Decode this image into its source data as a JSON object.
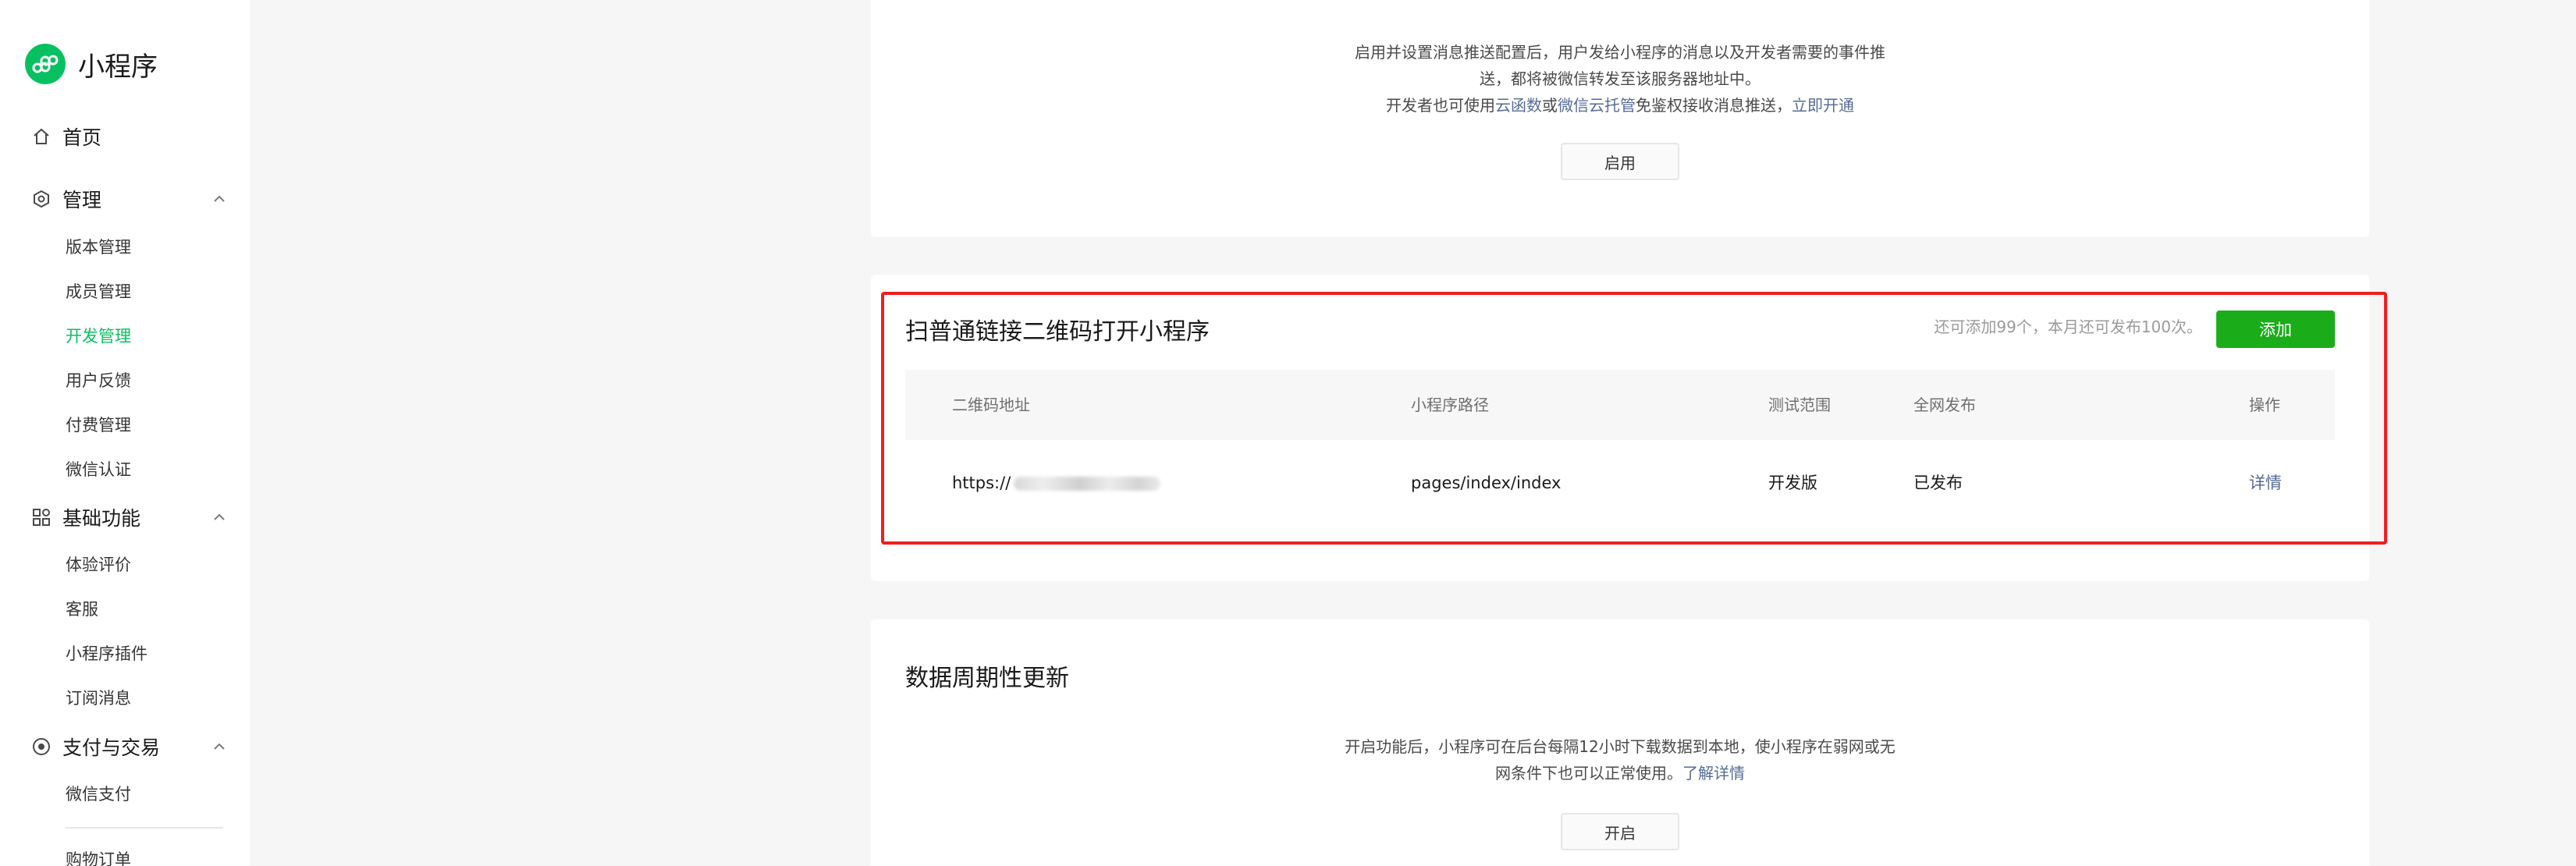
{
  "sidebar": {
    "brand": "小程序",
    "home": "首页",
    "groups": [
      {
        "title": "管理",
        "items": [
          "版本管理",
          "成员管理",
          "开发管理",
          "用户反馈",
          "付费管理",
          "微信认证"
        ]
      },
      {
        "title": "基础功能",
        "items": [
          "体验评价",
          "客服",
          "小程序插件",
          "订阅消息"
        ]
      },
      {
        "title": "支付与交易",
        "items": [
          "微信支付",
          "购物订单"
        ]
      }
    ],
    "active_item": "开发管理"
  },
  "push_card": {
    "line1": "启用并设置消息推送配置后，用户发给小程序的消息以及开发者需要的事件推",
    "line2": "送，都将被微信转发至该服务器地址中。",
    "line3_prefix": "开发者也可使用",
    "link_cloud_func": "云函数",
    "line3_or": "或",
    "link_cloud_host": "微信云托管",
    "line3_suffix": "免鉴权接收消息推送，",
    "link_open": "立即开通",
    "enable_button": "启用"
  },
  "qr_card": {
    "title": "扫普通链接二维码打开小程序",
    "quota": "还可添加99个，本月还可发布100次。",
    "add_button": "添加",
    "columns": [
      "二维码地址",
      "小程序路径",
      "测试范围",
      "全网发布",
      "操作"
    ],
    "rows": [
      {
        "url": "https://",
        "path": "pages/index/index",
        "scope": "开发版",
        "status": "已发布",
        "action": "详情"
      }
    ]
  },
  "data_card": {
    "title": "数据周期性更新",
    "line1": "开启功能后，小程序可在后台每隔12小时下载数据到本地，使小程序在弱网或无",
    "line2_prefix": "网条件下也可以正常使用。",
    "link_detail": "了解详情",
    "enable_button": "开启"
  },
  "colors": {
    "brand_green": "#07c160",
    "primary_button": "#1aad19",
    "link": "#576b95",
    "highlight_border": "#ef1f1f"
  }
}
